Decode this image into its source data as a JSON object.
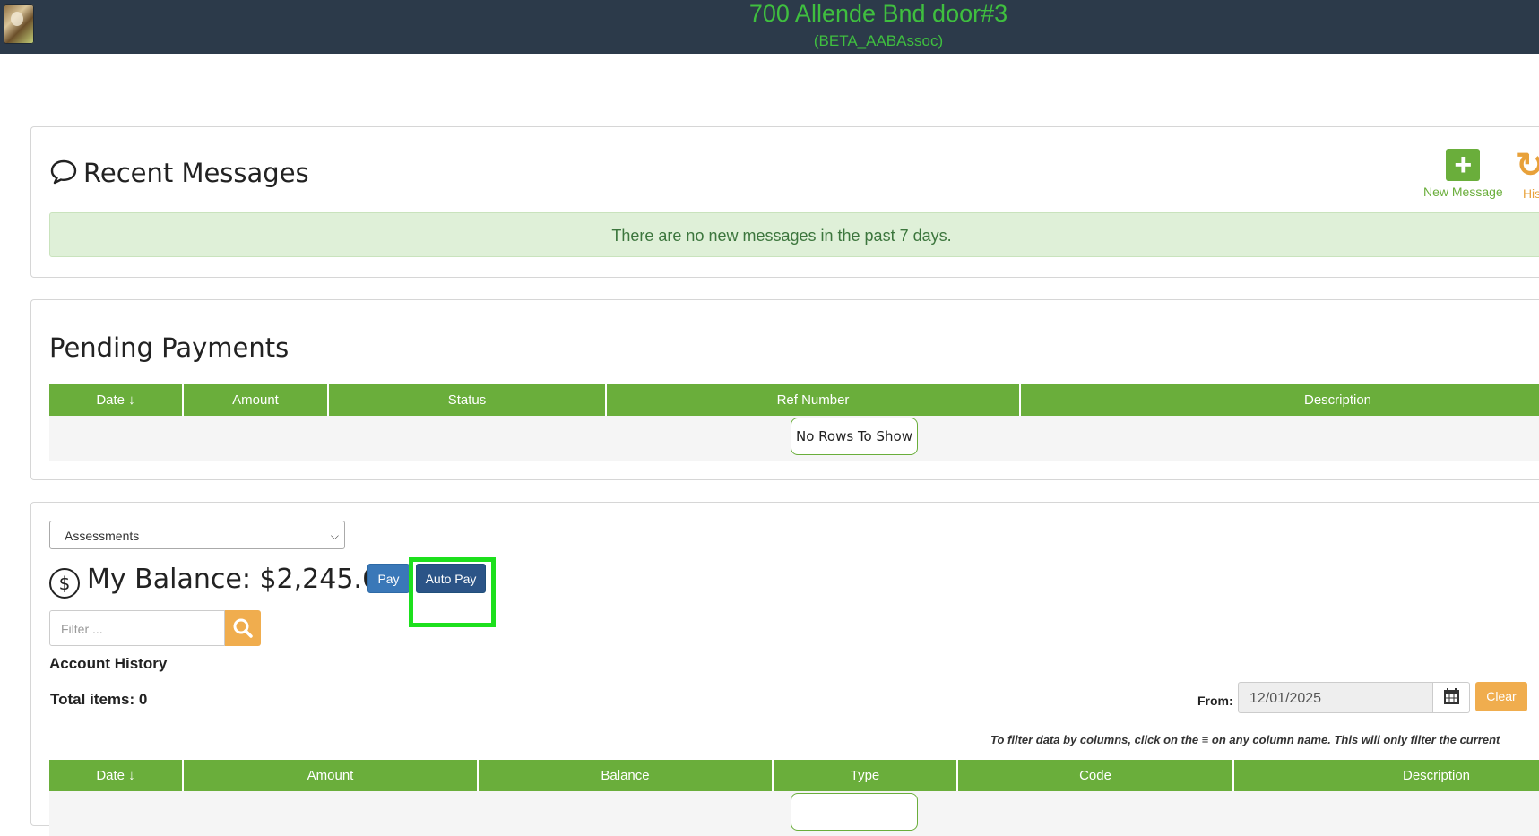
{
  "header": {
    "title": "700 Allende Bnd door#3",
    "subtitle": "(BETA_AABAssoc)"
  },
  "messages": {
    "title": "Recent Messages",
    "empty_text": "There are no new messages in the past 7 days.",
    "new_message_label": "New Message",
    "history_label": "Hist"
  },
  "pending": {
    "title": "Pending Payments",
    "columns": [
      "Date",
      "Amount",
      "Status",
      "Ref Number",
      "Description"
    ],
    "empty_text": "No Rows To Show"
  },
  "account": {
    "select_value": "Assessments",
    "balance_label": "My Balance: $2,245.62",
    "pay_label": "Pay",
    "auto_pay_label": "Auto Pay",
    "filter_placeholder": "Filter ...",
    "history_title": "Account History",
    "total_items": "Total items: 0",
    "from_label": "From:",
    "from_value": "12/01/2025",
    "clear_label": "Clear",
    "hint": "To filter data by columns, click on the ≡ on any column name. This will only filter the current",
    "columns": [
      "Date",
      "Amount",
      "Balance",
      "Type",
      "Code",
      "Description"
    ]
  },
  "colors": {
    "accent_green": "#6aae3b",
    "header_bg": "#2c3a4a",
    "title_green": "#3fbf3f",
    "highlight": "#1de01d"
  }
}
